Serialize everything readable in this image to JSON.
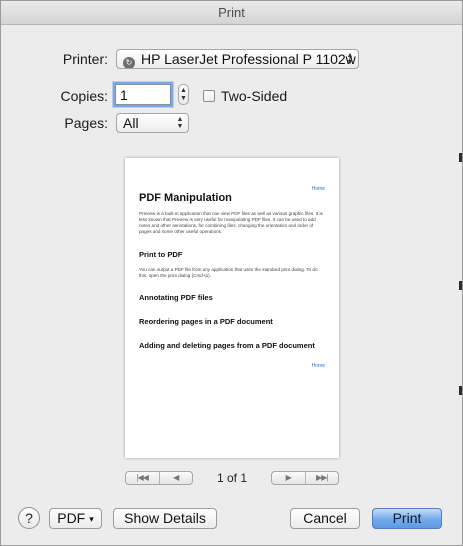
{
  "window": {
    "title": "Print"
  },
  "printer": {
    "label": "Printer:",
    "value": "HP LaserJet Professional P 1102w"
  },
  "copies": {
    "label": "Copies:",
    "value": "1"
  },
  "two_sided": {
    "label": "Two-Sided",
    "checked": false
  },
  "pages": {
    "label": "Pages:",
    "value": "All"
  },
  "preview": {
    "home_top": "Home",
    "title": "PDF Manipulation",
    "intro": "Preview is a built-in application that can view PDF files as well as various graphic files. It is less known that Preview is very useful for manipulating PDF files. It can be used to add notes and other annotations, for combining files, changing the orientation and order of pages and some other useful operations.",
    "section1": "Print to PDF",
    "section1_text": "You can output a PDF file from any application that uses the standard print dialog. To do this, open the print dialog (Cmd+p).",
    "section2": "Annotating PDF files",
    "section3": "Reordering pages in a PDF document",
    "section4": "Adding and deleting pages from a PDF document",
    "home_bottom": "Home"
  },
  "navigation": {
    "page_indicator": "1 of 1",
    "first_label": "|◀◀",
    "prev_label": "◀",
    "next_label": "▶",
    "last_label": "▶▶|"
  },
  "footer": {
    "help_label": "?",
    "pdf_label": "PDF",
    "pdf_arrow": "▾",
    "show_details_label": "Show Details",
    "cancel_label": "Cancel",
    "print_label": "Print"
  }
}
